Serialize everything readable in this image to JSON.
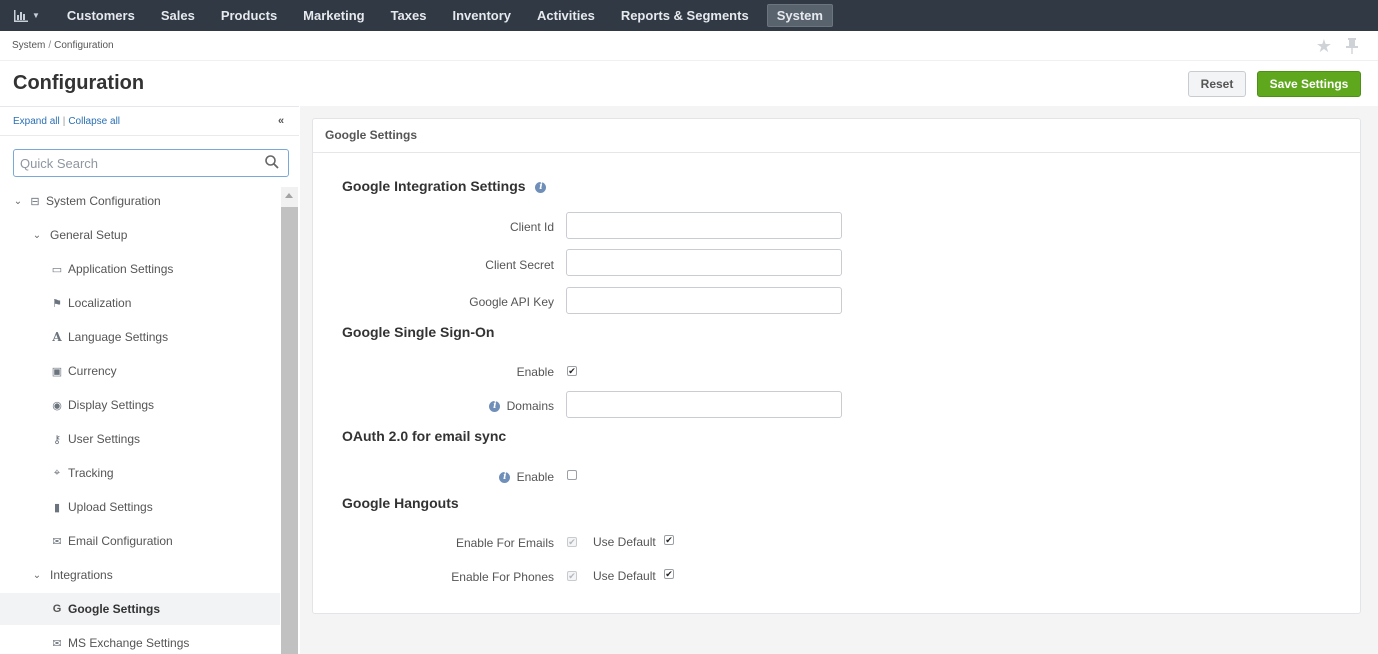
{
  "nav": {
    "items": [
      "Customers",
      "Sales",
      "Products",
      "Marketing",
      "Taxes",
      "Inventory",
      "Activities",
      "Reports & Segments",
      "System"
    ],
    "active": "System"
  },
  "breadcrumb": [
    "System",
    "Configuration"
  ],
  "page": {
    "title": "Configuration",
    "reset_label": "Reset",
    "save_label": "Save Settings"
  },
  "sidebar": {
    "expand_all": "Expand all",
    "collapse_all": "Collapse all",
    "search_placeholder": "Quick Search",
    "items": [
      {
        "label": "System Configuration",
        "icon": "drive-icon",
        "expanded": true
      },
      {
        "label": "General Setup",
        "expanded": true
      },
      {
        "label": "Application Settings",
        "icon": "monitor-icon"
      },
      {
        "label": "Localization",
        "icon": "flag-icon"
      },
      {
        "label": "Language Settings",
        "icon": "font-icon"
      },
      {
        "label": "Currency",
        "icon": "money-icon"
      },
      {
        "label": "Display Settings",
        "icon": "eye-icon"
      },
      {
        "label": "User Settings",
        "icon": "key-icon"
      },
      {
        "label": "Tracking",
        "icon": "crosshairs-icon"
      },
      {
        "label": "Upload Settings",
        "icon": "file-icon"
      },
      {
        "label": "Email Configuration",
        "icon": "envelope-icon"
      },
      {
        "label": "Integrations",
        "expanded": true
      },
      {
        "label": "Google Settings",
        "icon": "google-icon",
        "selected": true
      },
      {
        "label": "MS Exchange Settings",
        "icon": "envelope-icon"
      }
    ]
  },
  "card": {
    "title": "Google Settings",
    "integration": {
      "heading": "Google Integration Settings",
      "client_id_label": "Client Id",
      "client_id_value": "",
      "client_secret_label": "Client Secret",
      "client_secret_value": "",
      "api_key_label": "Google API Key",
      "api_key_value": ""
    },
    "sso": {
      "heading": "Google Single Sign-On",
      "enable_label": "Enable",
      "enable_checked": true,
      "domains_label": "Domains",
      "domains_value": ""
    },
    "oauth": {
      "heading": "OAuth 2.0 for email sync",
      "enable_label": "Enable",
      "enable_checked": false
    },
    "hangouts": {
      "heading": "Google Hangouts",
      "emails_label": "Enable For Emails",
      "emails_checked": true,
      "emails_default_label": "Use Default",
      "emails_default_checked": true,
      "phones_label": "Enable For Phones",
      "phones_checked": true,
      "phones_default_label": "Use Default",
      "phones_default_checked": true
    }
  },
  "colors": {
    "nav_bg": "#303944",
    "save_green": "#5fa81e",
    "link_blue": "#2a6fb3",
    "info_blue": "#6f8fb9"
  }
}
